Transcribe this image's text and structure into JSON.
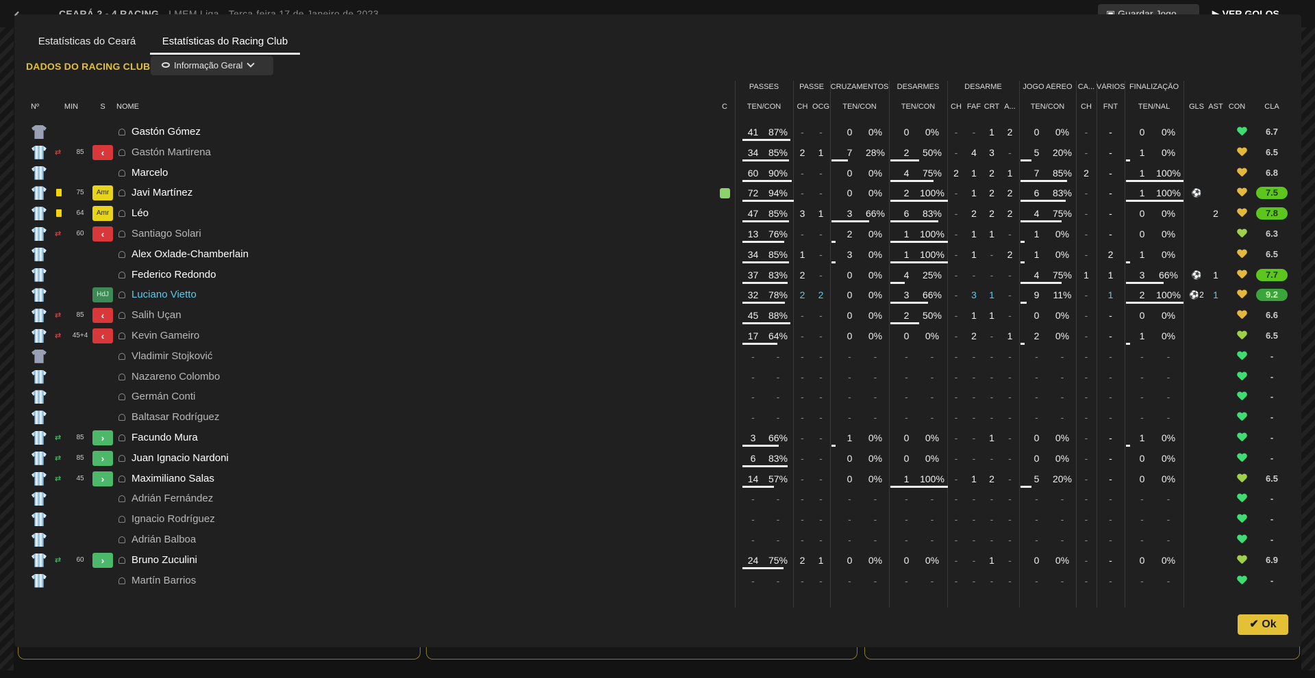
{
  "background": {
    "match_title": "CEARÁ 2 - 4 RACING",
    "competition": "LMEM Liga",
    "date": "Terça-feira 17 de Janeiro de 2023",
    "save_button": "Guardar Jogo",
    "goals_button": "VER GOLOS"
  },
  "tabs": [
    "Estatísticas do Ceará",
    "Estatísticas do Racing Club"
  ],
  "section_title": "DADOS DO RACING CLUB",
  "view_select": "Informação Geral",
  "group_headers": [
    "PASSES",
    "PASSE",
    "CRUZAMENTOS",
    "DESARMES",
    "DESARME",
    "JOGO AÉREO",
    "CA...",
    "VÁRIOS",
    "FINALIZAÇÃO"
  ],
  "col_headers": [
    "Nº",
    "MIN",
    "S",
    "NOME",
    "C",
    "TEN/CON",
    "CH",
    "OCG",
    "TEN/CON",
    "TEN/CON",
    "CH",
    "FAF",
    "CRT",
    "A...",
    "TEN/CON",
    "CH",
    "FNT",
    "TEN/NAL",
    "GLS",
    "AST",
    "CON",
    "CLA"
  ],
  "players": [
    {
      "name": "Gastón Gómez",
      "gk": true,
      "shirt": "1",
      "stats": [
        "41",
        "87%",
        "-",
        "-",
        "0",
        "0%",
        "0",
        "0%",
        "-",
        "-",
        "1",
        "2",
        "0",
        "0%",
        "-",
        "-",
        "0",
        "0%",
        "",
        ""
      ],
      "rating": "6.7",
      "morale": "green"
    },
    {
      "name": "Gastón Martirena",
      "sub": "off",
      "min": "85",
      "badge": "red",
      "stats": [
        "34",
        "85%",
        "2",
        "1",
        "7",
        "28%",
        "2",
        "50%",
        "-",
        "4",
        "3",
        "-",
        "5",
        "20%",
        "-",
        "-",
        "1",
        "0%",
        "",
        ""
      ],
      "rating": "6.5",
      "morale": "gold"
    },
    {
      "name": "Marcelo",
      "stats": [
        "60",
        "90%",
        "-",
        "-",
        "0",
        "0%",
        "4",
        "75%",
        "2",
        "1",
        "2",
        "1",
        "7",
        "85%",
        "2",
        "-",
        "1",
        "100%",
        "",
        ""
      ],
      "rating": "6.8",
      "morale": "gold"
    },
    {
      "name": "Javi Martínez",
      "card": "yellow",
      "min": "75",
      "badge": "amr",
      "badge_text": "Amr",
      "captain": true,
      "stats": [
        "72",
        "94%",
        "-",
        "-",
        "0",
        "0%",
        "2",
        "100%",
        "-",
        "1",
        "2",
        "2",
        "6",
        "83%",
        "-",
        "-",
        "1",
        "100%",
        "⚽",
        ""
      ],
      "rating": "7.5",
      "rating_class": "good",
      "morale": "gold"
    },
    {
      "name": "Léo",
      "card": "yellow",
      "min": "64",
      "badge": "amr",
      "badge_text": "Amr",
      "stats": [
        "47",
        "85%",
        "3",
        "1",
        "3",
        "66%",
        "6",
        "83%",
        "-",
        "2",
        "2",
        "2",
        "4",
        "75%",
        "-",
        "-",
        "0",
        "0%",
        "",
        "2"
      ],
      "rating": "7.8",
      "rating_class": "good",
      "morale": "gold"
    },
    {
      "name": "Santiago Solari",
      "sub": "off",
      "min": "60",
      "badge": "red",
      "stats": [
        "13",
        "76%",
        "-",
        "-",
        "2",
        "0%",
        "1",
        "100%",
        "-",
        "1",
        "1",
        "-",
        "1",
        "0%",
        "-",
        "-",
        "0",
        "0%",
        "",
        ""
      ],
      "rating": "6.3",
      "morale": "lime"
    },
    {
      "name": "Alex Oxlade-Chamberlain",
      "stats": [
        "34",
        "85%",
        "1",
        "-",
        "3",
        "0%",
        "1",
        "100%",
        "-",
        "1",
        "-",
        "2",
        "1",
        "0%",
        "-",
        "2",
        "1",
        "0%",
        "",
        ""
      ],
      "rating": "6.5",
      "morale": "gold"
    },
    {
      "name": "Federico Redondo",
      "stats": [
        "37",
        "83%",
        "2",
        "-",
        "0",
        "0%",
        "4",
        "25%",
        "-",
        "-",
        "-",
        "-",
        "4",
        "75%",
        "1",
        "1",
        "3",
        "66%",
        "⚽",
        "1"
      ],
      "rating": "7.7",
      "rating_class": "good",
      "morale": "gold"
    },
    {
      "name": "Luciano Vietto",
      "badge": "hdj",
      "badge_text": "HdJ",
      "highlight": true,
      "stats": [
        "32",
        "78%",
        "2",
        "2",
        "0",
        "0%",
        "3",
        "66%",
        "-",
        "3",
        "1",
        "-",
        "9",
        "11%",
        "-",
        "1",
        "2",
        "100%",
        "⚽2",
        "1"
      ],
      "rating": "9.2",
      "rating_class": "top",
      "morale": "gold"
    },
    {
      "name": "Salih Uçan",
      "sub": "off",
      "min": "85",
      "badge": "red",
      "stats": [
        "45",
        "88%",
        "-",
        "-",
        "0",
        "0%",
        "2",
        "50%",
        "-",
        "1",
        "1",
        "-",
        "0",
        "0%",
        "-",
        "-",
        "0",
        "0%",
        "",
        ""
      ],
      "rating": "6.6",
      "morale": "gold"
    },
    {
      "name": "Kevin Gameiro",
      "sub": "off",
      "min": "45+4",
      "badge": "red",
      "stats": [
        "17",
        "64%",
        "-",
        "-",
        "0",
        "0%",
        "0",
        "0%",
        "-",
        "2",
        "-",
        "1",
        "2",
        "0%",
        "-",
        "-",
        "1",
        "0%",
        "",
        ""
      ],
      "rating": "6.5",
      "morale": "lime"
    },
    {
      "name": "Vladimir Stojković",
      "gk": true,
      "bench": true,
      "stats": [],
      "rating": "-",
      "morale": "green"
    },
    {
      "name": "Nazareno Colombo",
      "bench": true,
      "stats": [],
      "rating": "-",
      "morale": "green"
    },
    {
      "name": "Germán Conti",
      "bench": true,
      "stats": [],
      "rating": "-",
      "morale": "green"
    },
    {
      "name": "Baltasar Rodríguez",
      "bench": true,
      "stats": [],
      "rating": "-",
      "morale": "green"
    },
    {
      "name": "Facundo Mura",
      "sub": "on",
      "min": "85",
      "badge": "green",
      "stats": [
        "3",
        "66%",
        "-",
        "-",
        "1",
        "0%",
        "0",
        "0%",
        "-",
        "-",
        "1",
        "-",
        "0",
        "0%",
        "-",
        "-",
        "1",
        "0%",
        "",
        ""
      ],
      "rating": "-",
      "morale": "green"
    },
    {
      "name": "Juan Ignacio Nardoni",
      "sub": "on",
      "min": "85",
      "badge": "green",
      "stats": [
        "6",
        "83%",
        "-",
        "-",
        "0",
        "0%",
        "0",
        "0%",
        "-",
        "-",
        "-",
        "-",
        "0",
        "0%",
        "-",
        "-",
        "0",
        "0%",
        "",
        ""
      ],
      "rating": "-",
      "morale": "green"
    },
    {
      "name": "Maximiliano Salas",
      "sub": "on",
      "min": "45",
      "badge": "green",
      "stats": [
        "14",
        "57%",
        "-",
        "-",
        "0",
        "0%",
        "1",
        "100%",
        "-",
        "1",
        "2",
        "-",
        "5",
        "20%",
        "-",
        "-",
        "0",
        "0%",
        "",
        ""
      ],
      "rating": "6.5",
      "morale": "lime"
    },
    {
      "name": "Adrián Fernández",
      "bench": true,
      "stats": [],
      "rating": "-",
      "morale": "green"
    },
    {
      "name": "Ignacio Rodríguez",
      "bench": true,
      "stats": [],
      "rating": "-",
      "morale": "green"
    },
    {
      "name": "Adrián Balboa",
      "bench": true,
      "stats": [],
      "rating": "-",
      "morale": "green"
    },
    {
      "name": "Bruno Zuculini",
      "sub": "on",
      "min": "60",
      "badge": "green",
      "stats": [
        "24",
        "75%",
        "2",
        "1",
        "0",
        "0%",
        "0",
        "0%",
        "-",
        "-",
        "1",
        "-",
        "0",
        "0%",
        "-",
        "-",
        "0",
        "0%",
        "",
        ""
      ],
      "rating": "6.9",
      "morale": "lime"
    },
    {
      "name": "Martín Barrios",
      "bench": true,
      "stats": [],
      "rating": "-",
      "morale": "green"
    }
  ],
  "ok_button": "Ok"
}
